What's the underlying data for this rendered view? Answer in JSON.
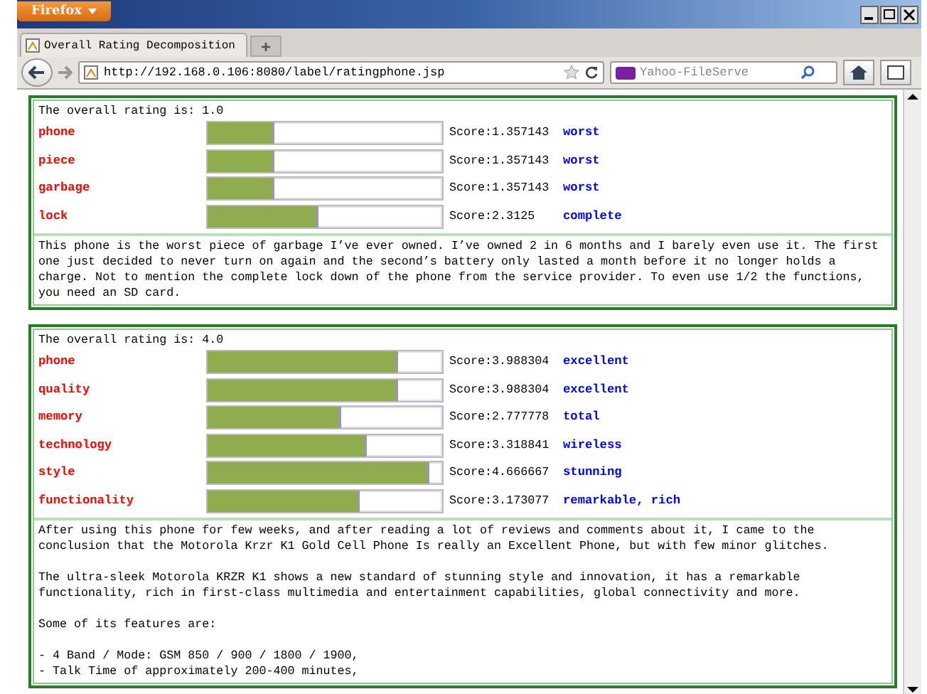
{
  "browser": {
    "menu_button": "Firefox",
    "tab_title": "Overall Rating Decomposition",
    "new_tab": "+",
    "url": "http://192.168.0.106:8080/label/ratingphone.jsp",
    "search": {
      "placeholder": "Yahoo-FileServe"
    }
  },
  "reviews": [
    {
      "overall": "The overall rating is: 1.0",
      "aspects": [
        {
          "term": "phone",
          "level": 0.27,
          "score": "Score:1.357143",
          "opinion": "worst"
        },
        {
          "term": "piece",
          "level": 0.27,
          "score": "Score:1.357143",
          "opinion": "worst"
        },
        {
          "term": "garbage",
          "level": 0.27,
          "score": "Score:1.357143",
          "opinion": "worst"
        },
        {
          "term": "lock",
          "level": 0.46,
          "score": "Score:2.3125",
          "opinion": "complete"
        }
      ],
      "paragraphs": [
        "This phone is the worst piece of garbage I’ve ever owned. I’ve owned 2 in 6 months and I barely even use it. The first one just decided to never turn on again and the second’s battery only lasted a month before it no longer holds a charge. Not to mention the complete lock down of the phone from the service provider. To even use 1/2 the functions, you need an SD card."
      ]
    },
    {
      "overall": "The overall rating is: 4.0",
      "aspects": [
        {
          "term": "phone",
          "level": 0.8,
          "score": "Score:3.988304",
          "opinion": "excellent"
        },
        {
          "term": "quality",
          "level": 0.8,
          "score": "Score:3.988304",
          "opinion": "excellent"
        },
        {
          "term": "memory",
          "level": 0.555,
          "score": "Score:2.777778",
          "opinion": "total"
        },
        {
          "term": "technology",
          "level": 0.665,
          "score": "Score:3.318841",
          "opinion": "wireless"
        },
        {
          "term": "style",
          "level": 0.935,
          "score": "Score:4.666667",
          "opinion": "stunning"
        },
        {
          "term": "functionality",
          "level": 0.635,
          "score": "Score:3.173077",
          "opinion": "remarkable, rich"
        }
      ],
      "paragraphs": [
        "After using this phone for few weeks, and after reading a lot of reviews and comments about it, I came to the conclusion that the Motorola Krzr K1 Gold Cell Phone Is really an Excellent Phone, but with few minor glitches.",
        "The ultra-sleek Motorola KRZR K1 shows a new standard of stunning style and innovation, it has a remarkable functionality, rich in first-class multimedia and entertainment capabilities, global connectivity and more.",
        "Some of its features are:"
      ],
      "list": [
        "- 4 Band / Mode: GSM 850 / 900 / 1800 / 1900,",
        "- Talk Time of approximately 200-400 minutes,"
      ]
    }
  ]
}
